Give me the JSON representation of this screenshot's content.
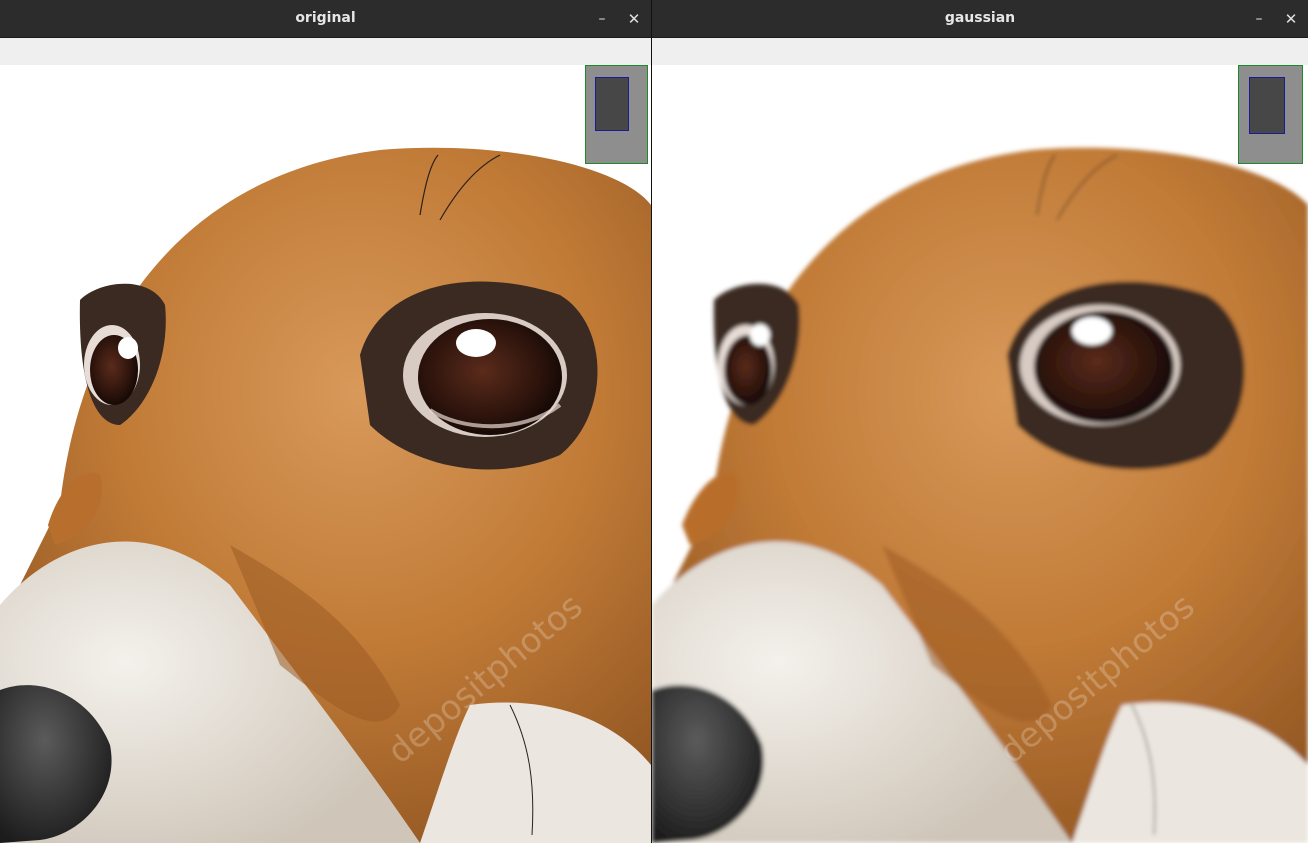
{
  "windows": [
    {
      "title": "original",
      "minimize_label": "–",
      "close_label": "✕"
    },
    {
      "title": "gaussian",
      "minimize_label": "–",
      "close_label": "✕"
    }
  ],
  "watermark": "depositphotos",
  "colors": {
    "titlebar": "#2c2c2c",
    "toolbar": "#efefef",
    "navigator_fill": "#8e8e8e",
    "navigator_border": "#1f8a2a",
    "viewport_fill": "#474747",
    "viewport_border": "#1a1a9c",
    "fur_orange": "#c9863f",
    "fur_white": "#e9e6e1",
    "eye_dark": "#2a1510"
  }
}
